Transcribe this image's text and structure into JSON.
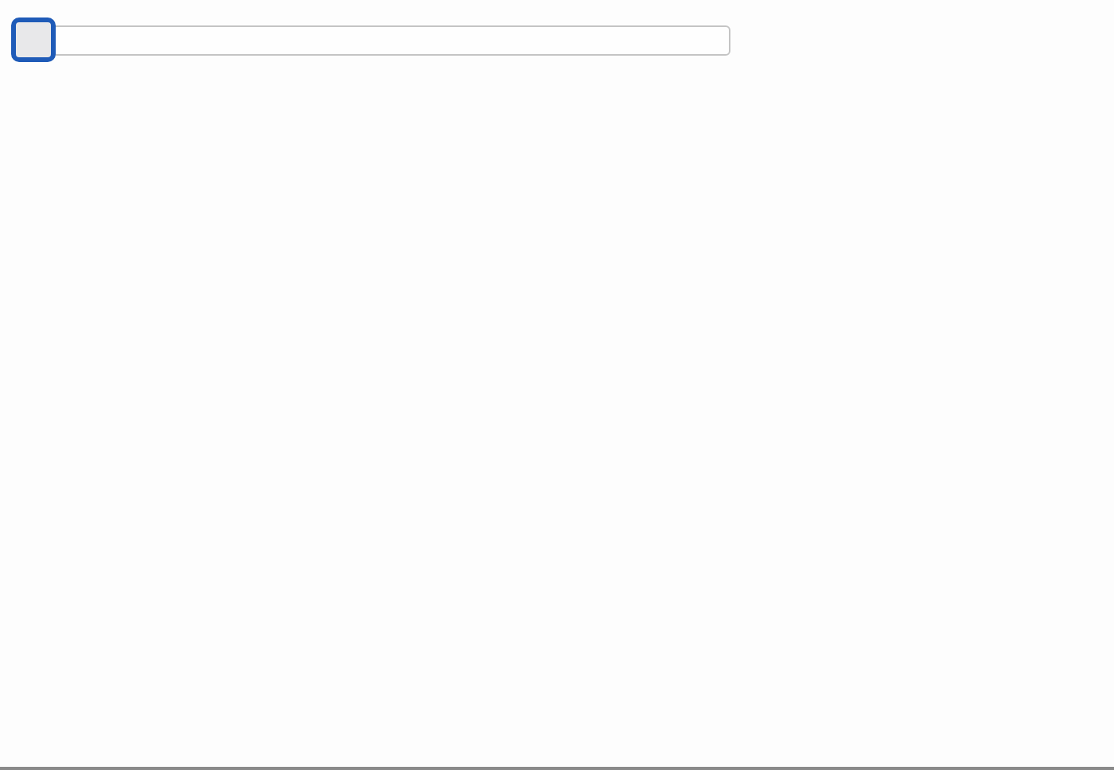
{
  "slider": {
    "level": 0,
    "focused": true
  }
}
